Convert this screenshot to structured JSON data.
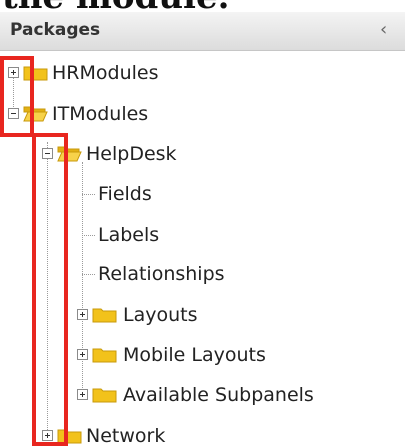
{
  "top_fragment": "the module.",
  "panel": {
    "title": "Packages",
    "collapse_glyph": "‹"
  },
  "tree": {
    "hr_modules": "HRModules",
    "it_modules": "ITModules",
    "help_desk": "HelpDesk",
    "fields": "Fields",
    "labels": "Labels",
    "relationships": "Relationships",
    "layouts": "Layouts",
    "mobile_layouts": "Mobile Layouts",
    "available_subpanels": "Available Subpanels",
    "network": "Network"
  },
  "colors": {
    "highlight": "#e8261f",
    "folder": "#f2c21b"
  }
}
